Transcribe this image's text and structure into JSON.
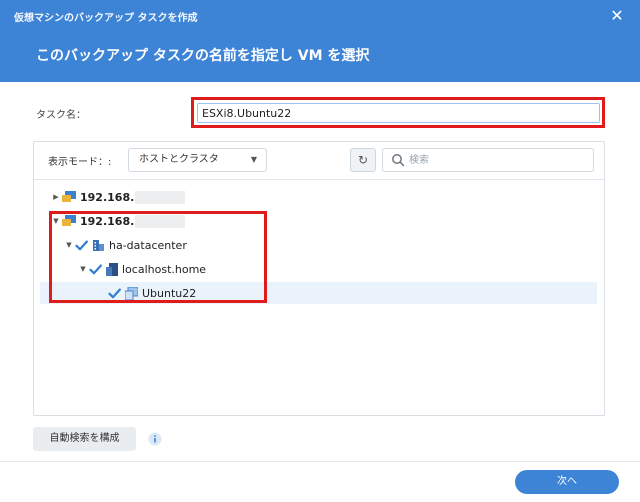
{
  "header": {
    "window_title": "仮想マシンのバックアップ タスクを作成",
    "close_glyph": "✕",
    "step_title": "このバックアップ タスクの名前を指定し VM を選択"
  },
  "task_name": {
    "label": "タスク名：",
    "value": "ESXi8.Ubuntu22"
  },
  "toolbar": {
    "mode_label": "表示モード：:",
    "mode_value": "ホストとクラスタ",
    "refresh_glyph": "↻",
    "search_placeholder": "検索"
  },
  "tree": {
    "host1": {
      "label": "192.168.",
      "expanded": false
    },
    "host2": {
      "label": "192.168.",
      "expanded": true
    },
    "datacenter": {
      "label": "ha-datacenter",
      "checked": true
    },
    "esxi_host": {
      "label": "localhost.home",
      "checked": true
    },
    "vm": {
      "label": "Ubuntu22",
      "checked": true,
      "selected": true
    }
  },
  "footer": {
    "auto_detect_label": "自動検索を構成",
    "next_label": "次へ"
  },
  "colors": {
    "accent": "#3d84d6",
    "highlight": "#e01b1b",
    "checkmark": "#2f7dd1"
  }
}
